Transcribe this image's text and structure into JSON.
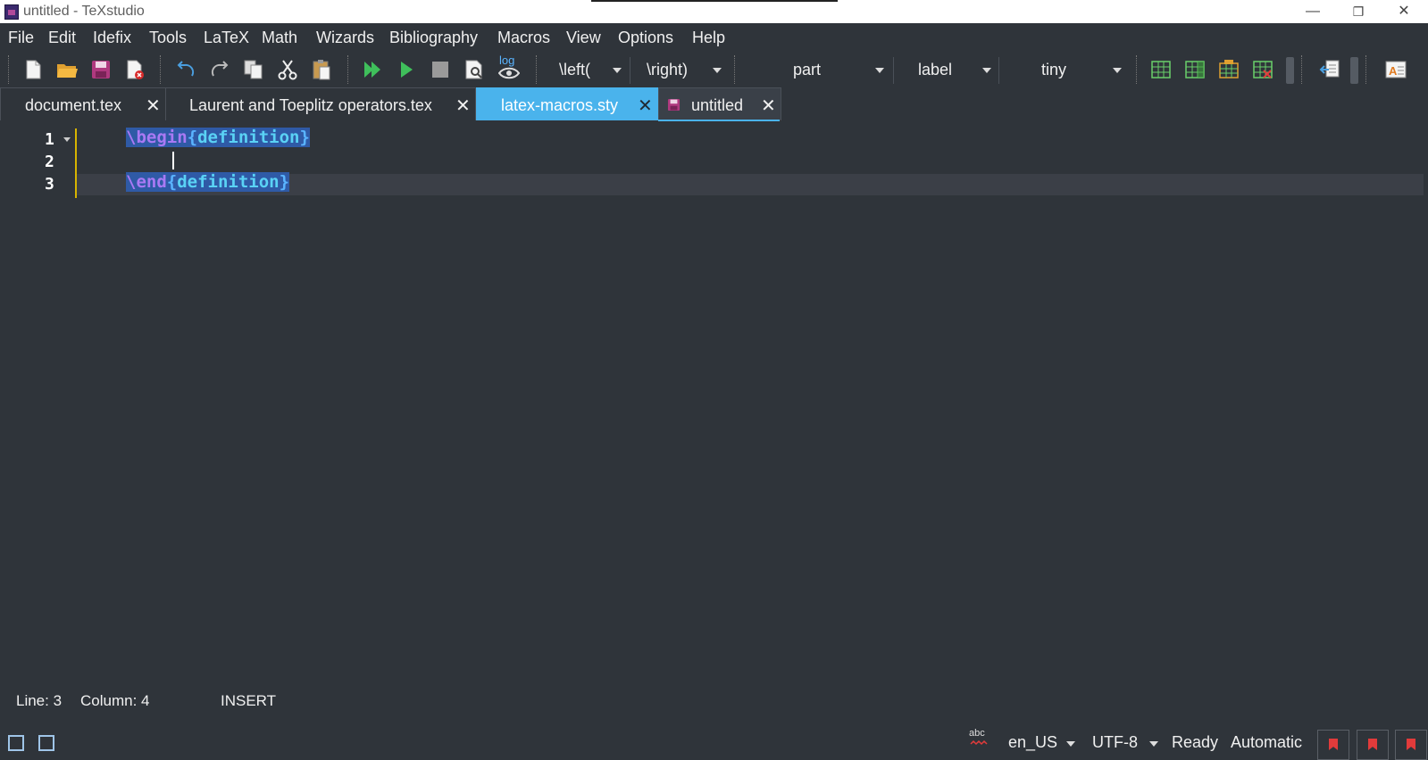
{
  "window": {
    "title": "untitled - TeXstudio",
    "minimize": "—",
    "restore": "❐",
    "close": "✕"
  },
  "menu": [
    "File",
    "Edit",
    "Idefix",
    "Tools",
    "LaTeX",
    "Math",
    "Wizards",
    "Bibliography",
    "Macros",
    "View",
    "Options",
    "Help"
  ],
  "toolbar": {
    "log_label": "log",
    "left_combo": "\\left(",
    "right_combo": "\\right)",
    "section_combo": "part",
    "ref_combo": "label",
    "size_combo": "tiny"
  },
  "tabs": [
    {
      "label": "document.tex",
      "close": "✕"
    },
    {
      "label": "Laurent and Toeplitz operators.tex",
      "close": "✕"
    },
    {
      "label": "latex-macros.sty",
      "close": "✕"
    },
    {
      "label": "untitled",
      "close": "✕"
    }
  ],
  "editor": {
    "line_numbers": [
      "1",
      "2",
      "3"
    ],
    "line1": {
      "cmd": "\\begin",
      "open": "{",
      "arg": "definition",
      "close": "}"
    },
    "line3": {
      "cmd": "\\end",
      "open": "{",
      "arg": "definition",
      "close": "}"
    }
  },
  "status": {
    "line": "Line: 3",
    "column": "Column: 4",
    "mode": "INSERT",
    "spell_icon_label": "abc",
    "language": "en_US",
    "encoding": "UTF-8",
    "state": "Ready",
    "automatic": "Automatic"
  },
  "colors": {
    "accent": "#4ab3ec",
    "bg": "#2f343a",
    "keyword": "#a979f4",
    "argument": "#5ad2f5",
    "gutter_marker": "#d7b400"
  }
}
